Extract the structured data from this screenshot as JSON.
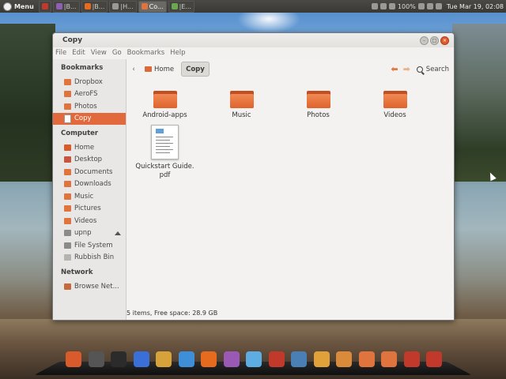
{
  "top_panel": {
    "menu_label": "Menu",
    "tasks": [
      {
        "label": "",
        "icon": "flag-icon",
        "color": "#c0392b"
      },
      {
        "label": "|B...",
        "icon": "app-icon",
        "color": "#8e5fb3"
      },
      {
        "label": "|B...",
        "icon": "firefox-icon",
        "color": "#e66b1f"
      },
      {
        "label": "|H...",
        "icon": "window-icon",
        "color": "#9a9a95"
      },
      {
        "label": "Co...",
        "icon": "folder-icon",
        "color": "#e0743f"
      },
      {
        "label": "|E...",
        "icon": "editor-icon",
        "color": "#6aa84f"
      }
    ],
    "battery": "100%",
    "clock": "Tue Mar 19, 02:08"
  },
  "window": {
    "title": "Copy",
    "menus": [
      "File",
      "Edit",
      "View",
      "Go",
      "Bookmarks",
      "Help"
    ]
  },
  "sidebar": {
    "bookmarks_heading": "Bookmarks",
    "bookmarks": [
      {
        "label": "Dropbox",
        "icon": "folder-icon"
      },
      {
        "label": "AeroFS",
        "icon": "folder-icon"
      },
      {
        "label": "Photos",
        "icon": "folder-icon"
      },
      {
        "label": "Copy",
        "icon": "document-icon",
        "selected": true
      }
    ],
    "computer_heading": "Computer",
    "computer": [
      {
        "label": "Home",
        "icon": "home-icon"
      },
      {
        "label": "Desktop",
        "icon": "desktop-icon"
      },
      {
        "label": "Documents",
        "icon": "folder-icon"
      },
      {
        "label": "Downloads",
        "icon": "folder-icon"
      },
      {
        "label": "Music",
        "icon": "folder-icon"
      },
      {
        "label": "Pictures",
        "icon": "folder-icon"
      },
      {
        "label": "Videos",
        "icon": "folder-icon"
      },
      {
        "label": "upnp",
        "icon": "drive-icon",
        "eject": true
      },
      {
        "label": "File System",
        "icon": "drive-icon"
      },
      {
        "label": "Rubbish Bin",
        "icon": "trash-icon"
      }
    ],
    "network_heading": "Network",
    "network": [
      {
        "label": "Browse Net...",
        "icon": "network-icon"
      }
    ]
  },
  "toolbar": {
    "crumbs": [
      "Home",
      "Copy"
    ],
    "search_label": "Search"
  },
  "files": [
    {
      "label": "Android-apps",
      "type": "folder"
    },
    {
      "label": "Music",
      "type": "folder"
    },
    {
      "label": "Photos",
      "type": "folder"
    },
    {
      "label": "Videos",
      "type": "folder"
    },
    {
      "label": "Quickstart Guide.\npdf",
      "type": "pdf"
    }
  ],
  "status": "5 items, Free space: 28.9 GB",
  "dock": [
    {
      "name": "ubuntu-icon",
      "color": "#d95a2a"
    },
    {
      "name": "settings-icon",
      "color": "#555555"
    },
    {
      "name": "terminal-icon",
      "color": "#2b2b2b"
    },
    {
      "name": "media-player-icon",
      "color": "#3a6fd8"
    },
    {
      "name": "picasa-icon",
      "color": "#d8a23a"
    },
    {
      "name": "weather-icon",
      "color": "#3f8fd8"
    },
    {
      "name": "firefox-icon",
      "color": "#e66b1f"
    },
    {
      "name": "chat-icon",
      "color": "#9b59b6"
    },
    {
      "name": "bird-icon",
      "color": "#5dade2"
    },
    {
      "name": "filezilla-icon",
      "color": "#c0392b"
    },
    {
      "name": "virtualbox-icon",
      "color": "#4a7fb5"
    },
    {
      "name": "files-icon",
      "color": "#e0a03a"
    },
    {
      "name": "documents-icon",
      "color": "#d98a3a"
    },
    {
      "name": "photos-icon",
      "color": "#e0743f"
    },
    {
      "name": "downloads-icon",
      "color": "#e0743f"
    },
    {
      "name": "video-icon",
      "color": "#c0392b"
    },
    {
      "name": "power-icon",
      "color": "#c0392b"
    }
  ]
}
